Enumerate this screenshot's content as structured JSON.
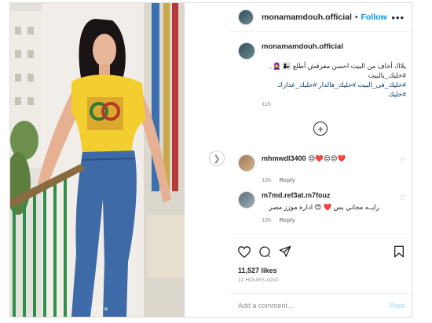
{
  "post": {
    "username": "monamamdouh.official",
    "separator": "•",
    "follow_label": "Follow",
    "more_label": "•••",
    "caption": {
      "username": "monamamdouh.official",
      "text": "يلااا، أخاف من البيت احسن مفرقش أطلع 👩‍👧 🧕.. #خليك_بالبيت",
      "tags": "#خليك_فى_البيت #خليك_فالدار #خليك_عدارك #خليك",
      "timestamp": "11h"
    },
    "load_more_symbol": "+",
    "comments": [
      {
        "username": "mhmwdl3400",
        "text": "😍❤️😍😍❤️",
        "age": "10h",
        "reply_label": "Reply"
      },
      {
        "username": "m7md.ref3at.m7fouz",
        "text": "رايــه مجاني بس ❤️ 😍 ادارة موزز مصر",
        "age": "10h",
        "reply_label": "Reply"
      }
    ],
    "likes": "11,527 likes",
    "time_ago": "11 HOURS AGO",
    "comment_placeholder": "Add a comment...",
    "post_button": "Post"
  },
  "icons": {
    "like": "heart-icon",
    "comment": "comment-icon",
    "share": "share-icon",
    "save": "bookmark-icon",
    "nav": "chevron-right-icon"
  },
  "colors": {
    "accent": "#0095f6",
    "hashtag": "#00376b",
    "muted": "#8e8e8e",
    "shirt": "#f2cf2f",
    "jeans": "#3f6aa8",
    "railing": "#2f8f4a"
  },
  "carousel": {
    "dots": 4,
    "active_index": 0
  }
}
